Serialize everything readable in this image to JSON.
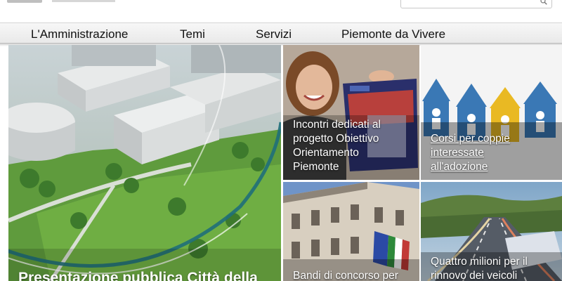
{
  "nav": {
    "items": [
      "L'Amministrazione",
      "Temi",
      "Servizi",
      "Piemonte da Vivere"
    ]
  },
  "hero": {
    "title": "Presentazione pubblica Città della"
  },
  "tiles": {
    "orientamento": {
      "caption": [
        "Incontri dedicati al",
        "progetto Obiettivo",
        "Orientamento",
        "Piemonte"
      ]
    },
    "adozione": {
      "caption": [
        "Corsi per coppie",
        "interessate",
        "all'adozione"
      ]
    },
    "bandi": {
      "caption": [
        "Bandi di concorso per"
      ]
    },
    "veicoli": {
      "caption": [
        "Quattro milioni per il",
        "rinnovo dei veicoli"
      ]
    }
  },
  "icons": {
    "search": "search-icon"
  },
  "colors": {
    "nav_bg": "#ececec",
    "hero_arc": "#1f6f7a",
    "house_blue": "#3a78b5",
    "house_yellow": "#e9b923"
  }
}
